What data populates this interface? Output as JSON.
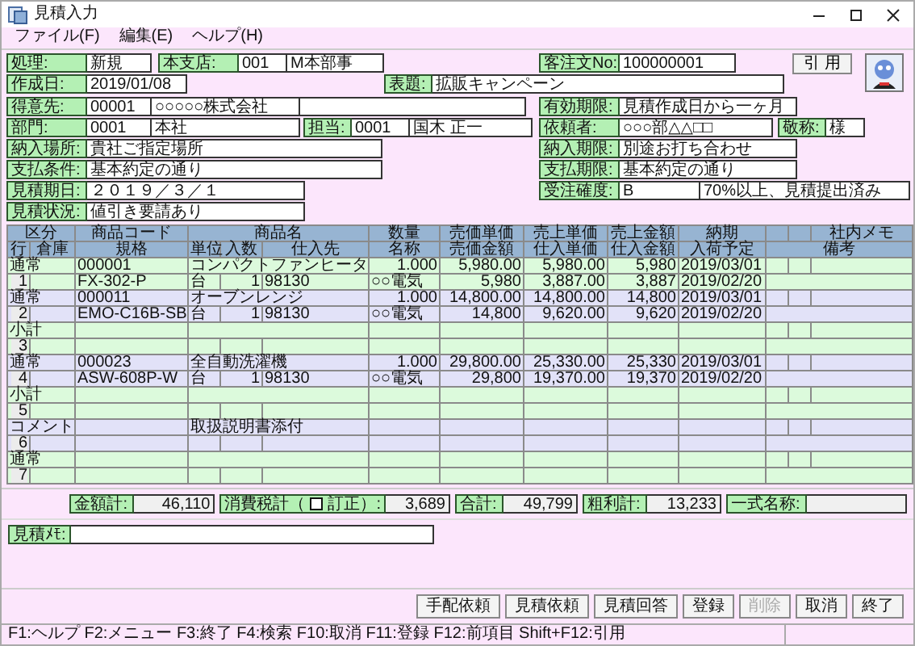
{
  "window": {
    "title": "見積入力"
  },
  "menu": [
    "ファイル(F)",
    "編集(E)",
    "ヘルプ(H)"
  ],
  "form": {
    "rows": [
      [
        {
          "label": "処理:",
          "values": [
            "新規"
          ]
        },
        {
          "label": "本支店:",
          "values": [
            "001",
            "M本部事"
          ]
        },
        {
          "label": "客注文No:",
          "values": [
            "100000001"
          ]
        }
      ],
      [
        {
          "label": "作成日:",
          "values": [
            "2019/01/08"
          ]
        },
        {
          "label": "表題:",
          "values": [
            "拡販キャンペーン"
          ]
        }
      ],
      [
        {
          "label": "得意先:",
          "values": [
            "00001",
            "○○○○○株式会社"
          ]
        },
        {
          "label": "有効期限:",
          "values": [
            "見積作成日から一ヶ月"
          ]
        }
      ],
      [
        {
          "label": "部門:",
          "values": [
            "0001",
            "本社"
          ]
        },
        {
          "label": "担当:",
          "values": [
            "0001",
            "国木 正一"
          ]
        },
        {
          "label": "依頼者:",
          "values": [
            "○○○部△△□□"
          ]
        },
        {
          "label": "敬称:",
          "values": [
            "様"
          ]
        }
      ],
      [
        {
          "label": "納入場所:",
          "values": [
            "貴社ご指定場所"
          ]
        },
        {
          "label": "納入期限:",
          "values": [
            "別途お打ち合わせ"
          ]
        }
      ],
      [
        {
          "label": "支払条件:",
          "values": [
            "基本約定の通り"
          ]
        },
        {
          "label": "支払期限:",
          "values": [
            "基本約定の通り"
          ]
        }
      ],
      [
        {
          "label": "見積期日:",
          "values": [
            "２０１９／３／１"
          ]
        },
        {
          "label": "受注確度:",
          "values": [
            "B",
            "70%以上、見積提出済み"
          ]
        }
      ],
      [
        {
          "label": "見積状況:",
          "values": [
            "値引き要請あり"
          ]
        }
      ]
    ],
    "quote_button": "引 用"
  },
  "table": {
    "header_top": [
      "区分",
      "商品コード",
      "商品名",
      "数量",
      "売価単価",
      "売上単価",
      "売上金額",
      "納期",
      "社内メモ"
    ],
    "header_bottom": [
      "行",
      "倉庫",
      "規格",
      "単位",
      "入数",
      "仕入先",
      "名称",
      "売価金額",
      "仕入単価",
      "仕入金額",
      "入荷予定",
      "備考"
    ],
    "rows": [
      {
        "line_no": "1",
        "category": "通常",
        "code": "000001",
        "name": "コンパクトファンヒータ",
        "quantity": "1.000",
        "sale_unit_price": "5,980.00",
        "sales_unit_price": "5,980.00",
        "sales_amount": "5,980",
        "delivery_date": "2019/03/01",
        "spec": "FX-302-P",
        "unit": "台",
        "pack_qty": "1",
        "supplier_code": "98130",
        "supplier_name": "○○電気",
        "sale_amount": "5,980",
        "purchase_unit_price": "3,887.00",
        "purchase_amount": "3,887",
        "arrival_date": "2019/02/20"
      },
      {
        "line_no": "2",
        "category": "通常",
        "code": "000011",
        "name": "オーブンレンジ",
        "quantity": "1.000",
        "sale_unit_price": "14,800.00",
        "sales_unit_price": "14,800.00",
        "sales_amount": "14,800",
        "delivery_date": "2019/03/01",
        "spec": "EMO-C16B-SB",
        "unit": "台",
        "pack_qty": "1",
        "supplier_code": "98130",
        "supplier_name": "○○電気",
        "sale_amount": "14,800",
        "purchase_unit_price": "9,620.00",
        "purchase_amount": "9,620",
        "arrival_date": "2019/02/20"
      },
      {
        "line_no": "3",
        "category": "小計"
      },
      {
        "line_no": "4",
        "category": "通常",
        "code": "000023",
        "name": "全自動洗濯機",
        "quantity": "1.000",
        "sale_unit_price": "29,800.00",
        "sales_unit_price": "25,330.00",
        "sales_amount": "25,330",
        "delivery_date": "2019/03/01",
        "spec": "ASW-608P-W",
        "unit": "台",
        "pack_qty": "1",
        "supplier_code": "98130",
        "supplier_name": "○○電気",
        "sale_amount": "29,800",
        "purchase_unit_price": "19,370.00",
        "purchase_amount": "19,370",
        "arrival_date": "2019/02/20"
      },
      {
        "line_no": "5",
        "category": "小計"
      },
      {
        "line_no": "6",
        "category": "コメント",
        "name": "取扱説明書添付"
      },
      {
        "line_no": "7",
        "category": "通常"
      }
    ]
  },
  "totals": [
    {
      "kind": "amount",
      "label": "金額計:",
      "value": "46,110"
    },
    {
      "kind": "tax",
      "label": "消費税計（",
      "label_after": "訂正）:",
      "correction_checked": false,
      "value": "3,689"
    },
    {
      "kind": "amount",
      "label": "合計:",
      "value": "49,799"
    },
    {
      "kind": "amount",
      "label": "粗利計:",
      "value": "13,233"
    },
    {
      "kind": "amount",
      "label": "一式名称:"
    }
  ],
  "memo": {
    "label": "見積ﾒﾓ:"
  },
  "buttons": [
    {
      "label": "手配依頼",
      "disabled": false
    },
    {
      "label": "見積依頼",
      "disabled": false
    },
    {
      "label": "見積回答",
      "disabled": false
    },
    {
      "label": "登録",
      "disabled": false
    },
    {
      "label": "削除",
      "disabled": true
    },
    {
      "label": "取消",
      "disabled": false
    },
    {
      "label": "終了",
      "disabled": false
    }
  ],
  "status_bar": "F1:ヘルプ F2:メニュー F3:終了 F4:検索 F10:取消 F11:登録 F12:前項目 Shift+F12:引用"
}
